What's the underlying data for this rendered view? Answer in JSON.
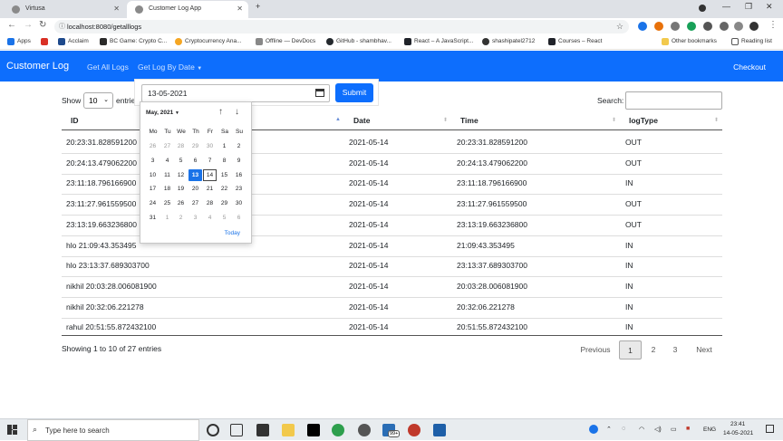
{
  "browser": {
    "tabs": [
      {
        "label": "Virtusa"
      },
      {
        "label": "Customer Log App"
      }
    ],
    "url": "localhost:8080/getalllogs",
    "bookmarks": [
      "Apps",
      "Acclaim",
      "BC Game: Crypto C...",
      "Cryptocurrency Ana...",
      "Offline — DevDocs",
      "GitHub - shambhav...",
      "React – A JavaScript...",
      "shashipatel2712",
      "Courses – React"
    ],
    "other_bookmarks": "Other bookmarks",
    "reading_list": "Reading list"
  },
  "navbar": {
    "brand": "Customer Log",
    "links": [
      "Get All Logs",
      "Get Log By Date"
    ],
    "checkout": "Checkout"
  },
  "date_form": {
    "value": "13-05-2021",
    "submit": "Submit"
  },
  "calendar": {
    "month": "May, 2021",
    "weekdays": [
      "Mo",
      "Tu",
      "We",
      "Th",
      "Fr",
      "Sa",
      "Su"
    ],
    "weeks": [
      [
        "26",
        "27",
        "28",
        "29",
        "30",
        "1",
        "2"
      ],
      [
        "3",
        "4",
        "5",
        "6",
        "7",
        "8",
        "9"
      ],
      [
        "10",
        "11",
        "12",
        "13",
        "14",
        "15",
        "16"
      ],
      [
        "17",
        "18",
        "19",
        "20",
        "21",
        "22",
        "23"
      ],
      [
        "24",
        "25",
        "26",
        "27",
        "28",
        "29",
        "30"
      ],
      [
        "31",
        "1",
        "2",
        "3",
        "4",
        "5",
        "6"
      ]
    ],
    "selected": "13",
    "today": "14",
    "today_label": "Today"
  },
  "table": {
    "show_label": "Show",
    "show_value": "10",
    "entries_label": "entries",
    "search_label": "Search:",
    "columns": [
      "ID",
      "Date",
      "Time",
      "logType"
    ],
    "rows": [
      [
        "20:23:31.828591200",
        "2021-05-14",
        "20:23:31.828591200",
        "OUT"
      ],
      [
        "20:24:13.479062200",
        "2021-05-14",
        "20:24:13.479062200",
        "OUT"
      ],
      [
        "23:11:18.796166900",
        "2021-05-14",
        "23:11:18.796166900",
        "IN"
      ],
      [
        "23:11:27.961559500",
        "2021-05-14",
        "23:11:27.961559500",
        "OUT"
      ],
      [
        "23:13:19.663236800",
        "2021-05-14",
        "23:13:19.663236800",
        "OUT"
      ],
      [
        "hlo 21:09:43.353495",
        "2021-05-14",
        "21:09:43.353495",
        "IN"
      ],
      [
        "hlo 23:13:37.689303700",
        "2021-05-14",
        "23:13:37.689303700",
        "IN"
      ],
      [
        "nikhil 20:03:28.006081900",
        "2021-05-14",
        "20:03:28.006081900",
        "IN"
      ],
      [
        "nikhil 20:32:06.221278",
        "2021-05-14",
        "20:32:06.221278",
        "IN"
      ],
      [
        "rahul 20:51:55.872432100",
        "2021-05-14",
        "20:51:55.872432100",
        "IN"
      ]
    ],
    "info": "Showing 1 to 10 of 27 entries",
    "pagination": {
      "previous": "Previous",
      "pages": [
        "1",
        "2",
        "3"
      ],
      "next": "Next"
    }
  },
  "taskbar": {
    "search_placeholder": "Type here to search",
    "badge": "99+",
    "lang": "ENG",
    "time": "23:41",
    "date": "14-05-2021"
  }
}
